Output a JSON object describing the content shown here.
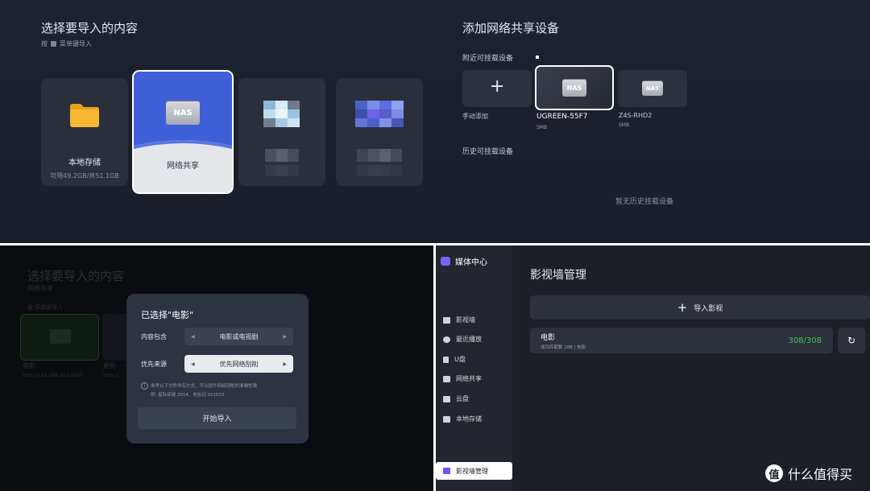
{
  "top": {
    "title": "选择要导入的内容",
    "hint_prefix": "按",
    "hint_suffix": "菜单键导入",
    "cards": [
      {
        "label": "本地存储",
        "sub": "可用49.2GB/共51.1GB"
      },
      {
        "label": "网络共享"
      }
    ],
    "nas_badge": "NAS",
    "right_title": "添加网络共享设备",
    "nearby_label": "附近可挂载设备",
    "devices": [
      {
        "name": "手动添加",
        "proto": "",
        "icon": "plus-icon"
      },
      {
        "name": "UGREEN-55F7",
        "proto": "SMB",
        "icon": "nas-icon"
      },
      {
        "name": "Z4S-RHD2",
        "proto": "SMB",
        "icon": "nas-icon"
      }
    ],
    "history_label": "历史可挂载设备",
    "history_empty": "暂无历史挂载设备"
  },
  "dialog": {
    "title": "已选择\"电影\"",
    "rows": [
      {
        "label": "内容包含",
        "value": "电影或电视剧"
      },
      {
        "label": "优先来源",
        "value": "优先网络刮削"
      }
    ],
    "note_line1": "参考以下文件命名方式，可以提升网络刮削的准确性哦",
    "note_line2": "例: 星际穿越 2014、老友记 S01E03",
    "start_button": "开始导入",
    "bg_title": "选择要导入的内容",
    "bg_sub": "网络共享",
    "bg_hint": "按  菜单键导入",
    "bg_card1": "电影",
    "bg_card1_sub": "smb://192.168.50.235/sh",
    "bg_card2": "更新",
    "bg_card2_sub": "smb://..."
  },
  "media": {
    "app_name": "媒体中心",
    "nav": [
      {
        "label": "影视墙",
        "icon": "film-icon"
      },
      {
        "label": "最近播放",
        "icon": "clock-icon"
      },
      {
        "label": "U盘",
        "icon": "usb-icon"
      },
      {
        "label": "网络共享",
        "icon": "nas-icon"
      },
      {
        "label": "云盘",
        "icon": "cloud-icon"
      },
      {
        "label": "本地存储",
        "icon": "folder-icon"
      }
    ],
    "active_nav": "影视墙管理",
    "page_title": "影视墙管理",
    "import_button": "导入影视",
    "library": {
      "name": "电影",
      "sub": "成功匹配数 288 | 电影",
      "count": "308/308"
    }
  },
  "watermark": {
    "logo": "值",
    "text": "什么值得买"
  },
  "colors": {
    "accent_blue": "#3f5fd8",
    "success_green": "#43c16b",
    "active_icon": "#6a55ff"
  }
}
